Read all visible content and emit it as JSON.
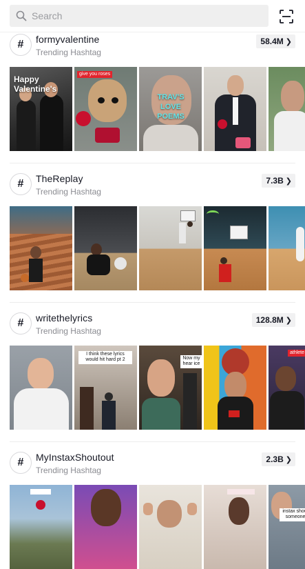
{
  "search": {
    "placeholder": "Search",
    "icon": "search-icon"
  },
  "scan_icon": "scan-icon",
  "sections": [
    {
      "hashtag": "formyvalentine",
      "subtitle": "Trending Hashtag",
      "count": "58.4M",
      "thumbnails": [
        {
          "caption": "Happy Valentine's"
        },
        {
          "caption": "give you roses"
        },
        {
          "caption": "TRAV'S LOVE POEMS"
        },
        {
          "caption": ""
        },
        {
          "caption": ""
        }
      ]
    },
    {
      "hashtag": "TheReplay",
      "subtitle": "Trending Hashtag",
      "count": "7.3B",
      "thumbnails": [
        {
          "caption": ""
        },
        {
          "caption": ""
        },
        {
          "caption": ""
        },
        {
          "caption": ""
        },
        {
          "caption": ""
        }
      ]
    },
    {
      "hashtag": "writethelyrics",
      "subtitle": "Trending Hashtag",
      "count": "128.8M",
      "thumbnails": [
        {
          "caption": ""
        },
        {
          "caption": "I think these lyrics would hit hard pt 2"
        },
        {
          "caption": "Now my hear ice"
        },
        {
          "caption": ""
        },
        {
          "caption": "athlete ed"
        }
      ]
    },
    {
      "hashtag": "MyInstaxShoutout",
      "subtitle": "Trending Hashtag",
      "count": "2.3B",
      "thumbnails": [
        {
          "caption": ""
        },
        {
          "caption": ""
        },
        {
          "caption": ""
        },
        {
          "caption": ""
        },
        {
          "caption": "instax shout someone"
        }
      ]
    }
  ]
}
